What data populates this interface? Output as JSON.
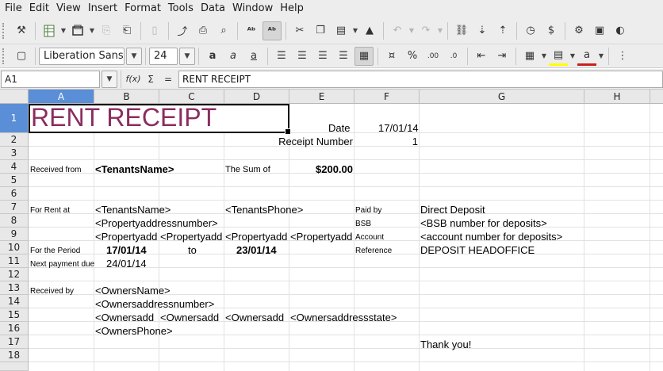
{
  "menu": [
    "File",
    "Edit",
    "View",
    "Insert",
    "Format",
    "Tools",
    "Data",
    "Window",
    "Help"
  ],
  "toolbar_icons": [
    "clone-formatting-icon",
    "new-spreadsheet-icon",
    "open-icon",
    "save-icon",
    "export-pdf-icon",
    "print-icon",
    "print-preview-icon",
    "spellcheck-icon",
    "autospellcheck-icon",
    "cut-icon",
    "copy-icon",
    "paste-icon",
    "clone-icon",
    "undo-icon",
    "redo-icon",
    "hyperlink-icon",
    "sort-ascending-icon",
    "sort-descending-icon",
    "chart-icon",
    "currency-icon",
    "settings-icon",
    "image-icon",
    "toggle-icon"
  ],
  "font": {
    "name": "Liberation Sans",
    "size": "24"
  },
  "formula_bar": {
    "cell_ref": "A1",
    "fx": "f(x)",
    "sum": "Σ",
    "equals": "=",
    "content": "RENT RECEIPT"
  },
  "columns": [
    "A",
    "B",
    "C",
    "D",
    "E",
    "F",
    "G",
    "H"
  ],
  "rows": [
    "1",
    "2",
    "3",
    "4",
    "5",
    "6",
    "7",
    "8",
    "9",
    "10",
    "11",
    "12",
    "13",
    "14",
    "15",
    "16",
    "17",
    "18"
  ],
  "cells": {
    "title": "RENT RECEIPT",
    "date_label": "Date",
    "date_value": "17/01/14",
    "receipt_number_label": "Receipt Number",
    "receipt_number_value": "1",
    "received_from_label": "Received from",
    "tenants_name": "<TenantsName>",
    "sum_label": "The Sum of",
    "sum_value": "$200.00",
    "for_rent_at_label": "For Rent at",
    "tenants_name_2": "<TenantsName>",
    "tenants_phone": "<TenantsPhone>",
    "paid_by_label": "Paid by",
    "paid_by_value": "Direct Deposit",
    "property_address_number": "<Propertyaddressnumber>",
    "bsb_label": "BSB",
    "bsb_value": "<BSB number for deposits>",
    "property_b9": "<Propertyadd",
    "property_c9": "<Propertyadd",
    "property_d9": "<Propertyadd",
    "property_e9": "<Propertyadd",
    "account_label": "Account",
    "account_value": "<account number for deposits>",
    "period_label": "For the Period",
    "period_from": "17/01/14",
    "period_to_label": "to",
    "period_to": "23/01/14",
    "reference_label": "Reference",
    "reference_value": "DEPOSIT HEADOFFICE",
    "next_payment_label": "Next payment due",
    "next_payment_value": "24/01/14",
    "received_by_label": "Received by",
    "owners_name": "<OwnersName>",
    "owners_address_number": "<Ownersaddressnumber>",
    "owners_b15": "<Ownersadd",
    "owners_c15": "<Ownersadd",
    "owners_d15": "<Ownersadd",
    "owners_state": "<Ownersaddressstate>",
    "owners_phone": "<OwnersPhone>",
    "thank_you": "Thank you!"
  },
  "colors": {
    "title": "#8b2c5f",
    "selection_header": "#5a8ed6"
  }
}
